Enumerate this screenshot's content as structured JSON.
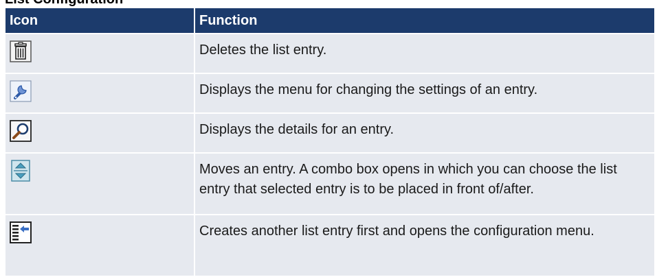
{
  "caption": {
    "text": "List Configuration"
  },
  "table": {
    "headers": {
      "icon": "Icon",
      "function": "Function"
    },
    "rows": [
      {
        "icon": "trash-icon",
        "function": "Deletes the list entry."
      },
      {
        "icon": "wrench-icon",
        "function": "Displays the menu for changing the settings of an entry."
      },
      {
        "icon": "magnifier-icon",
        "function": "Displays the details for an entry."
      },
      {
        "icon": "move-up-down-icon",
        "function": "Moves an entry. A combo box opens in which you can choose the list entry that selected entry is to be placed in front of/after."
      },
      {
        "icon": "insert-entry-icon",
        "function": "Creates another list entry first and opens the configuration menu."
      }
    ]
  }
}
